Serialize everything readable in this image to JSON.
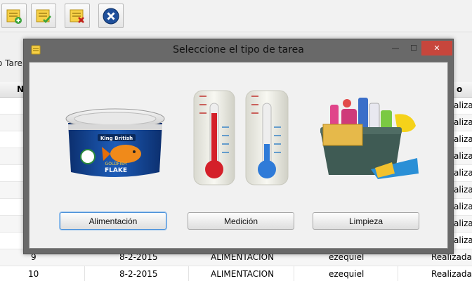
{
  "toolbar": {
    "buttons": [
      {
        "name": "add-task",
        "icon": "list-add-icon"
      },
      {
        "name": "edit-task",
        "icon": "list-edit-icon"
      },
      {
        "name": "delete-task",
        "icon": "list-delete-icon"
      },
      {
        "name": "exit",
        "icon": "close-circle-icon"
      }
    ]
  },
  "background": {
    "label_partial": "o Tare",
    "table": {
      "headers": {
        "col1": "N",
        "col5": "o"
      },
      "right_column_values": [
        "alizada",
        "alizada",
        "alizada",
        "alizada",
        "alizada",
        "alizada",
        "alizada",
        "alizada",
        "alizada",
        "Realizada"
      ],
      "rows": [
        {
          "num": "9",
          "date": "8-2-2015",
          "type": "ALIMENTACION",
          "user": "ezequiel",
          "status": "Realizada"
        },
        {
          "num": "10",
          "date": "8-2-2015",
          "type": "ALIMENTACION",
          "user": "ezequiel",
          "status": "Realizada"
        }
      ]
    }
  },
  "dialog": {
    "title": "Seleccione el tipo de tarea",
    "controls": {
      "minimize": "—",
      "maximize": "☐",
      "close": "✕"
    },
    "options": [
      {
        "label": "Alimentación",
        "image": "fish-food-can-image",
        "can_brand": "King British",
        "can_product": "GOLDFISH",
        "can_subproduct": "FLAKE"
      },
      {
        "label": "Medición",
        "image": "thermometers-image"
      },
      {
        "label": "Limpieza",
        "image": "cleaning-supplies-image"
      }
    ]
  }
}
